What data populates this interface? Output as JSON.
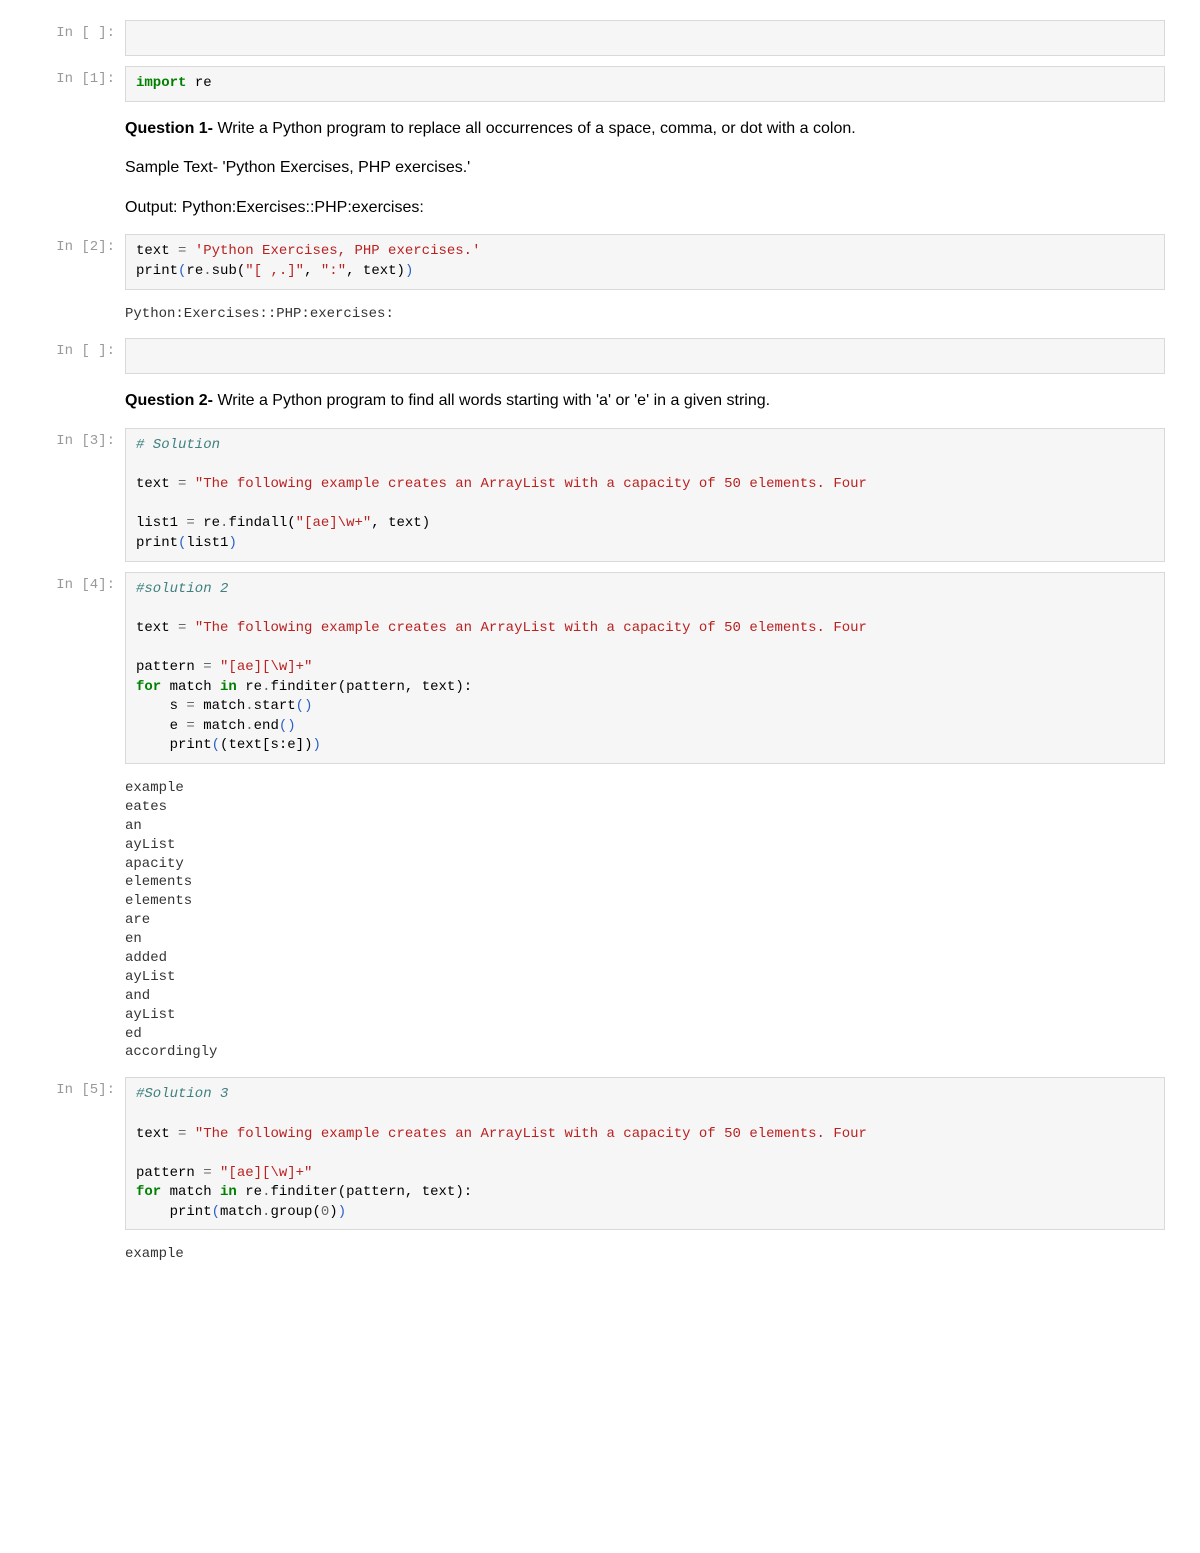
{
  "prompts": {
    "empty1": "In [ ]:",
    "c1": "In [1]:",
    "c2": "In [2]:",
    "empty2": "In [ ]:",
    "c3": "In [3]:",
    "c4": "In [4]:",
    "c5": "In [5]:"
  },
  "code1": {
    "kw_import": "import",
    "mod": " re"
  },
  "question1": {
    "title": "Question 1-",
    "text": " Write a Python program to replace all occurrences of a space, comma, or dot with a colon.",
    "sample": "Sample Text- 'Python Exercises, PHP exercises.'",
    "output": "Output: Python:Exercises::PHP:exercises:"
  },
  "code2": {
    "l1_a": "text ",
    "l1_eq": "=",
    "l1_b": " ",
    "l1_str": "'Python Exercises, PHP exercises.'",
    "l2_a": "print",
    "l2_b": "(",
    "l2_c": "re",
    "l2_d": ".",
    "l2_e": "sub",
    "l2_f": "(",
    "l2_g": "\"[ ,.]\"",
    "l2_h": ", ",
    "l2_i": "\":\"",
    "l2_j": ", text",
    "l2_k": ")",
    "l2_l": ")"
  },
  "out2": "Python:Exercises::PHP:exercises:",
  "question2": {
    "title": "Question 2-",
    "text": " Write a Python program to find all words starting with 'a' or 'e' in a given string."
  },
  "code3": {
    "cm": "# Solution",
    "l2_a": "text ",
    "l2_eq": "=",
    "l2_b": " ",
    "l2_str": "\"The following example creates an ArrayList with a capacity of 50 elements. Four",
    "l3_a": "list1 ",
    "l3_eq": "=",
    "l3_b": " re",
    "l3_c": ".",
    "l3_d": "findall",
    "l3_e": "(",
    "l3_f": "\"[ae]\\w+\"",
    "l3_g": ", text",
    "l3_h": ")",
    "l4_a": "print",
    "l4_b": "(",
    "l4_c": "list1",
    "l4_d": ")"
  },
  "code4": {
    "cm": "#solution 2",
    "l2_a": "text ",
    "l2_eq": "=",
    "l2_b": " ",
    "l2_str": "\"The following example creates an ArrayList with a capacity of 50 elements. Four",
    "l3_a": "pattern ",
    "l3_eq": "=",
    "l3_b": " ",
    "l3_str": "\"[ae][\\w]+\"",
    "l4_for": "for",
    "l4_a": " match ",
    "l4_in": "in",
    "l4_b": " re",
    "l4_c": ".",
    "l4_d": "finditer",
    "l4_e": "(",
    "l4_f": "pattern, text",
    "l4_g": ")",
    "l4_h": ":",
    "l5_a": "    s ",
    "l5_eq": "=",
    "l5_b": " match",
    "l5_c": ".",
    "l5_d": "start",
    "l5_e": "(",
    "l5_f": ")",
    "l6_a": "    e ",
    "l6_eq": "=",
    "l6_b": " match",
    "l6_c": ".",
    "l6_d": "end",
    "l6_e": "(",
    "l6_f": ")",
    "l7_a": "    print",
    "l7_b": "(",
    "l7_c": "(",
    "l7_d": "text",
    "l7_e": "[",
    "l7_f": "s",
    "l7_g": ":",
    "l7_h": "e",
    "l7_i": "]",
    "l7_j": ")",
    "l7_k": ")"
  },
  "out4": "example\neates\nan\nayList\napacity\nelements\nelements\nare\nen\nadded\nayList\nand\nayList\ned\naccordingly",
  "code5": {
    "cm": "#Solution 3",
    "l2_a": "text ",
    "l2_eq": "=",
    "l2_b": " ",
    "l2_str": "\"The following example creates an ArrayList with a capacity of 50 elements. Four",
    "l3_a": "pattern ",
    "l3_eq": "=",
    "l3_b": " ",
    "l3_str": "\"[ae][\\w]+\"",
    "l4_for": "for",
    "l4_a": " match ",
    "l4_in": "in",
    "l4_b": " re",
    "l4_c": ".",
    "l4_d": "finditer",
    "l4_e": "(",
    "l4_f": "pattern, text",
    "l4_g": ")",
    "l4_h": ":",
    "l5_a": "    print",
    "l5_b": "(",
    "l5_c": "match",
    "l5_d": ".",
    "l5_e": "group",
    "l5_f": "(",
    "l5_g": "0",
    "l5_h": ")",
    "l5_i": ")"
  },
  "out5": "example"
}
